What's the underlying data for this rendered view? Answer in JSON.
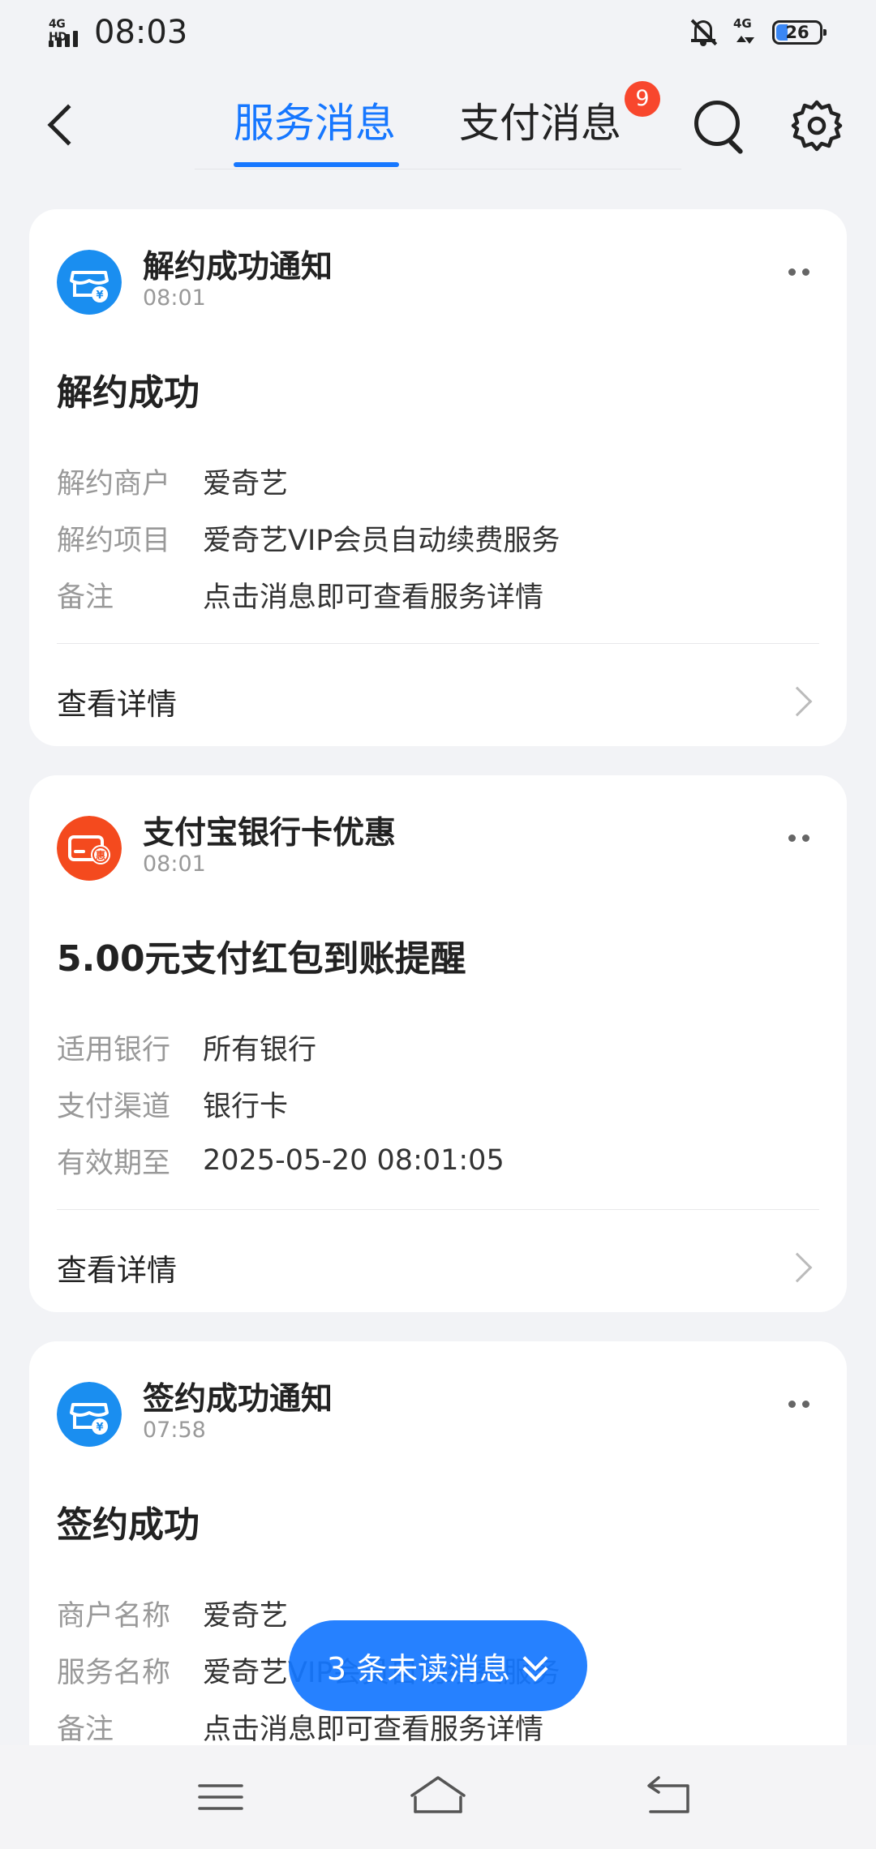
{
  "status_bar": {
    "network": "4G HD",
    "time": "08:03",
    "mobile_data": "4G",
    "battery": "26",
    "battery_percent": 26
  },
  "header": {
    "tabs": [
      {
        "label": "服务消息",
        "active": true
      },
      {
        "label": "支付消息",
        "active": false,
        "badge": "9"
      }
    ]
  },
  "colors": {
    "accent": "#1677ff",
    "badge": "#f8472d",
    "service_icon": "#1a8ef0",
    "promo_icon": "#f44a1e"
  },
  "cards": [
    {
      "icon": "store-yuan-icon",
      "title": "解约成功通知",
      "time": "08:01",
      "headline": "解约成功",
      "rows": [
        {
          "key": "解约商户",
          "value": "爱奇艺"
        },
        {
          "key": "解约项目",
          "value": "爱奇艺VIP会员自动续费服务"
        },
        {
          "key": "备注",
          "value": "点击消息即可查看服务详情"
        }
      ],
      "detail_label": "查看详情"
    },
    {
      "icon": "bank-card-discount-icon",
      "title": "支付宝银行卡优惠",
      "time": "08:01",
      "headline": "5.00元支付红包到账提醒",
      "rows": [
        {
          "key": "适用银行",
          "value": "所有银行"
        },
        {
          "key": "支付渠道",
          "value": "银行卡"
        },
        {
          "key": "有效期至",
          "value": "2025-05-20 08:01:05"
        }
      ],
      "detail_label": "查看详情"
    },
    {
      "icon": "store-yuan-icon",
      "title": "签约成功通知",
      "time": "07:58",
      "headline": "签约成功",
      "rows": [
        {
          "key": "商户名称",
          "value": "爱奇艺"
        },
        {
          "key": "服务名称",
          "value": "爱奇艺VIP会员自动续费服务"
        },
        {
          "key": "备注",
          "value": "点击消息即可查看服务详情"
        }
      ]
    }
  ],
  "unread_pill": {
    "label": "3 条未读消息"
  }
}
